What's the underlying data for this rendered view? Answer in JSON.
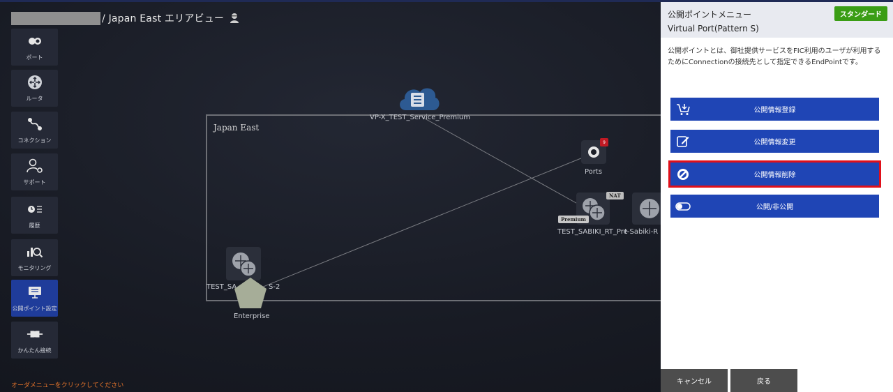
{
  "header": {
    "title": "/ Japan East エリアビュー"
  },
  "nav": [
    {
      "label": "ポート",
      "icon": "port-icon"
    },
    {
      "label": "ルータ",
      "icon": "router-icon"
    },
    {
      "label": "コネクション",
      "icon": "connection-icon"
    },
    {
      "label": "サポート",
      "icon": "support-icon"
    },
    {
      "label": "履歴",
      "icon": "history-icon"
    },
    {
      "label": "モニタリング",
      "icon": "monitoring-icon"
    },
    {
      "label": "公開ポイント設定",
      "icon": "public-point-icon"
    },
    {
      "label": "かんたん接続",
      "icon": "easy-connect-icon"
    }
  ],
  "order_hint": "オーダメニューをクリックしてください",
  "canvas": {
    "region_label": "Japan East",
    "cloud_label": "VP-X_TEST_Service_Premium",
    "ports_label": "Ports",
    "ports_count": "9",
    "router1_label": "TEST_SABIKI_RT_Pre",
    "router2_label": "t-Sabiki-R",
    "router3_label": "TEST_SA",
    "router3_label_suffix": "S-2",
    "premium_badge": "Premium",
    "nat_badge": "NAT",
    "enterprise_label": "Enterprise"
  },
  "panel": {
    "title": "公開ポイントメニュー",
    "subtitle": "Virtual Port(Pattern S)",
    "badge": "スタンダード",
    "description": "公開ポイントとは、御社提供サービスをFIC利用のユーザが利用するためにConnectionの接続先として指定できるEndPointです。",
    "menu": [
      {
        "label": "公開情報登録",
        "icon": "cart-add-icon"
      },
      {
        "label": "公開情報変更",
        "icon": "edit-icon"
      },
      {
        "label": "公開情報削除",
        "icon": "prohibit-icon"
      },
      {
        "label": "公開/非公開",
        "icon": "toggle-icon"
      }
    ],
    "cancel_label": "キャンセル",
    "back_label": "戻る"
  },
  "colors": {
    "accent": "#1f45b5",
    "standard_badge": "#3a9d14",
    "selected_outline": "#e0101a",
    "hint": "#e3732b"
  }
}
